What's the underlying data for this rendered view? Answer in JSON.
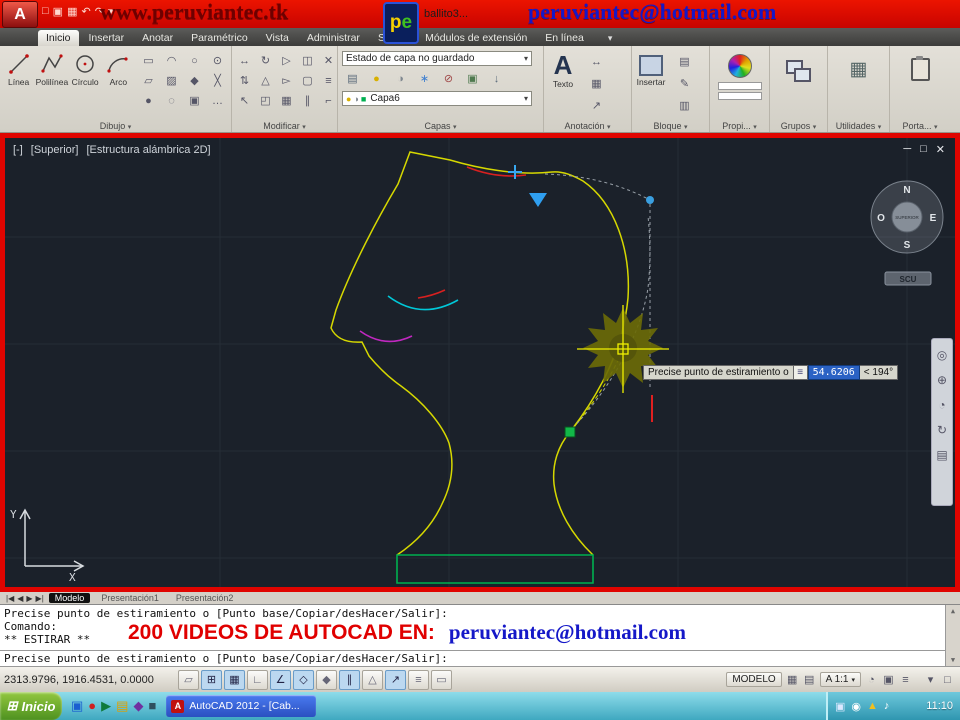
{
  "ui": {
    "caret": "▾"
  },
  "banner": {
    "app_initial": "A",
    "qat_icons": [
      "□",
      "▣",
      "▦",
      "↶",
      "↷",
      "▾"
    ],
    "site": "www.peruviantec.tk",
    "pe_badge": {
      "p": "p",
      "e": "e"
    },
    "title_fragment": "ballito3...",
    "email": "peruviantec@hotmail.com"
  },
  "tabs": [
    {
      "label": "Inicio",
      "active": true
    },
    {
      "label": "Insertar"
    },
    {
      "label": "Anotar"
    },
    {
      "label": "Paramétrico"
    },
    {
      "label": "Vista"
    },
    {
      "label": "Administrar"
    },
    {
      "label": "Salida"
    },
    {
      "label": "Módulos de extensión"
    },
    {
      "label": "En línea"
    }
  ],
  "ribbon": {
    "dibujo": {
      "label": "Dibujo",
      "big": [
        {
          "label": "Línea"
        },
        {
          "label": "Polilínea"
        },
        {
          "label": "Círculo"
        },
        {
          "label": "Arco"
        }
      ],
      "grid": [
        "▭",
        "◠",
        "○",
        "⊙",
        "▱",
        "▨",
        "◆",
        "╳",
        "●",
        "◌",
        "▣",
        "…"
      ]
    },
    "modificar": {
      "label": "Modificar",
      "grid": [
        "↔",
        "↻",
        "▷",
        "◫",
        "✕",
        "⇅",
        "△",
        "▻",
        "▢",
        "≡",
        "↖",
        "◰",
        "▦",
        "∥",
        "⌐"
      ]
    },
    "capas": {
      "label": "Capas",
      "state": "Estado de capa no guardado",
      "tools": [
        {
          "glyph": "▤",
          "color": "#5a6a7a"
        },
        {
          "glyph": "●",
          "color": "#d8b000"
        },
        {
          "glyph": "◑",
          "color": "#808890"
        },
        {
          "glyph": "∗",
          "color": "#4080d0"
        },
        {
          "glyph": "⊘",
          "color": "#a04848"
        },
        {
          "glyph": "▣",
          "color": "#4f7a4f"
        },
        {
          "glyph": "↓",
          "color": "#5a6a7a"
        }
      ],
      "layer_icons": [
        {
          "glyph": "●",
          "color": "#d8b000"
        },
        {
          "glyph": "◑",
          "color": "#808890"
        },
        {
          "glyph": "■",
          "color": "#00b050"
        }
      ],
      "layer": "Capa6"
    },
    "anotacion": {
      "label": "Anotación",
      "glyph": "A",
      "texto": "Texto",
      "tools": [
        "↔",
        "▦",
        "↗"
      ]
    },
    "bloque": {
      "label": "Bloque",
      "insertar": "Insertar",
      "tools": [
        "▤",
        "✎",
        "▥"
      ]
    },
    "propiedades": {
      "label": "Propi..."
    },
    "grupos": {
      "label": "Grupos"
    },
    "utilidades": {
      "label": "Utilidades",
      "icon": "▦"
    },
    "portapapeles": {
      "label": "Porta..."
    }
  },
  "viewport": {
    "label_collapse": "[-]",
    "label_view": "[Superior]",
    "label_visual": "[Estructura alámbrica 2D]",
    "win_min": "─",
    "win_restore": "□",
    "win_close": "✕",
    "viewcube": {
      "n": "N",
      "e": "E",
      "s": "S",
      "o": "O",
      "center": "SUPERIOR",
      "scu": "SCU"
    },
    "navbar_icons": [
      "◎",
      "⊕",
      "◔",
      "↻",
      "▤"
    ],
    "dyninput": {
      "prompt": "Precise punto de estiramiento o",
      "hint_icon": "≡",
      "value": "54.6206",
      "angle": "< 194°"
    },
    "axis_x": "X",
    "axis_y": "Y"
  },
  "layout_tabs": {
    "nav": [
      "|◀",
      "◀",
      "▶",
      "▶|"
    ],
    "items": [
      {
        "label": "Modelo",
        "active": true
      },
      {
        "label": "Presentación1"
      },
      {
        "label": "Presentación2"
      }
    ]
  },
  "command": {
    "history": [
      "Precise punto de estiramiento o [Punto base/Copiar/desHacer/Salir]:",
      "Comando:",
      "** ESTIRAR **"
    ],
    "promo_red": "200 VIDEOS DE AUTOCAD EN:",
    "promo_email": "peruviantec@hotmail.com",
    "prompt": "Precise punto de estiramiento o [Punto base/Copiar/desHacer/Salir]:",
    "scroll_up": "▲",
    "scroll_down": "▼"
  },
  "statusbar": {
    "coords": "2313.9796, 1916.4531, 0.0000",
    "toggles": [
      {
        "glyph": "▱",
        "active": false
      },
      {
        "glyph": "⊞",
        "active": true
      },
      {
        "glyph": "▦",
        "active": true
      },
      {
        "glyph": "∟",
        "active": false
      },
      {
        "glyph": "∠",
        "active": true
      },
      {
        "glyph": "◇",
        "active": true
      },
      {
        "glyph": "◆",
        "active": false
      },
      {
        "glyph": "∥",
        "active": true
      },
      {
        "glyph": "△",
        "active": false
      },
      {
        "glyph": "↗",
        "active": true
      },
      {
        "glyph": "≡",
        "active": false
      },
      {
        "glyph": "▭",
        "active": false
      }
    ],
    "modelo": "MODELO",
    "group1": [
      "▦",
      "▤"
    ],
    "scale": "A 1:1",
    "group2": [
      "◔",
      "▣",
      "≡"
    ],
    "far": [
      "▾",
      "□"
    ]
  },
  "taskbar": {
    "start_icon": "⊞",
    "start": "Inicio",
    "quicklaunch": [
      {
        "glyph": "▣",
        "color": "#1a5fd0"
      },
      {
        "glyph": "●",
        "color": "#d02020"
      },
      {
        "glyph": "▶",
        "color": "#0f7a3a"
      },
      {
        "glyph": "▤",
        "color": "#e0a000"
      },
      {
        "glyph": "◆",
        "color": "#7030a0"
      },
      {
        "glyph": "■",
        "color": "#2f4f5f"
      }
    ],
    "task": {
      "icon": "A",
      "label": "AutoCAD 2012 - [Cab..."
    },
    "tray_icons": [
      {
        "glyph": "▣",
        "color": "#dce8ff"
      },
      {
        "glyph": "◉",
        "color": "#ffffff"
      },
      {
        "glyph": "▲",
        "color": "#f0c020"
      },
      {
        "glyph": "♪",
        "color": "#ffffff"
      }
    ],
    "clock": "11:10"
  }
}
